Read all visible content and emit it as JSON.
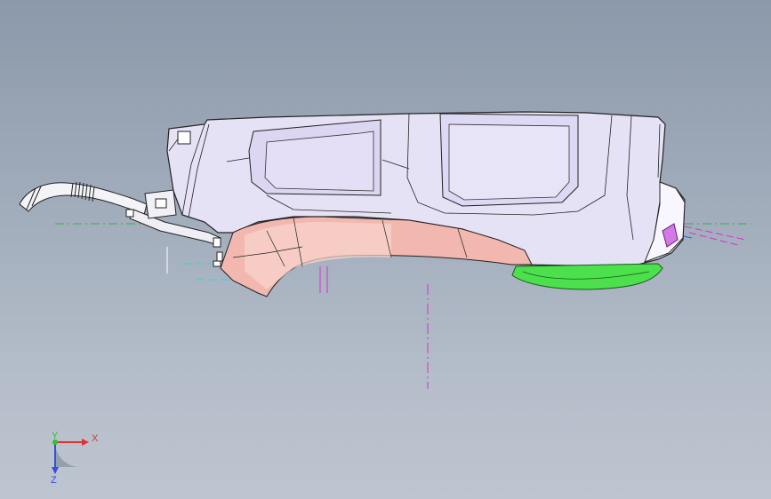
{
  "viewport": {
    "background_top": "#8c99aa",
    "background_bottom": "#bdc5d0"
  },
  "model": {
    "parts": [
      {
        "id": "upper-housing",
        "color": "#e6e2f6"
      },
      {
        "id": "side-trim",
        "color": "#f2b8b0"
      },
      {
        "id": "bottom-clip",
        "color": "#4ce04c"
      },
      {
        "id": "rear-connector",
        "color": "#d27ae4"
      },
      {
        "id": "hose",
        "color": "#f4f4f8"
      }
    ],
    "reference_lines": {
      "green": "#2fb34a",
      "magenta": "#d62fd2",
      "cyan": "#33d6d6"
    }
  },
  "triad": {
    "x_label": "X",
    "y_label": "Y",
    "z_label": "Z",
    "x_color": "#e03030",
    "y_color": "#30c030",
    "z_color": "#3050e0"
  }
}
